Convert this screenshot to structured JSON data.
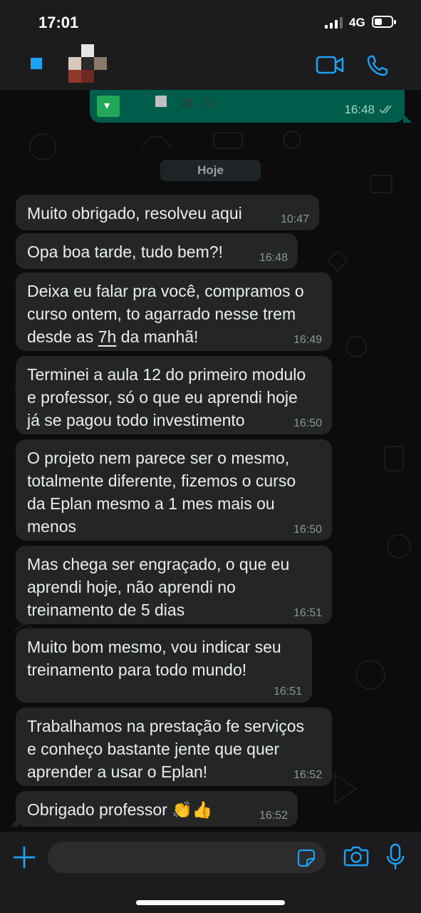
{
  "status_bar": {
    "time": "17:01",
    "network": "4G",
    "battery_level": 0.45
  },
  "header": {
    "back_icon": "back-chevron-icon",
    "avatar": "contact-avatar",
    "video_icon": "video-call-icon",
    "phone_icon": "voice-call-icon"
  },
  "sent_message": {
    "time": "16:48",
    "status_icon": "double-check-icon"
  },
  "date_divider": "Hoje",
  "messages": [
    {
      "lines": [
        "Muito obrigado, resolveu aqui"
      ],
      "time": "10:47"
    },
    {
      "lines": [
        "Opa boa tarde, tudo bem?!"
      ],
      "time": "16:48"
    },
    {
      "lines": [
        "Deixa eu falar pra você, compramos o",
        "curso ontem, to agarrado nesse trem",
        "desde as 7h da manhã!"
      ],
      "time": "16:49"
    },
    {
      "lines": [
        "Terminei a aula 12 do primeiro modulo",
        "e professor, só o que eu aprendi hoje",
        "já se pagou todo investimento"
      ],
      "time": "16:50"
    },
    {
      "lines": [
        "O projeto nem parece ser o mesmo,",
        "totalmente diferente, fizemos o curso",
        "da Eplan mesmo a 1 mes mais ou",
        "menos"
      ],
      "time": "16:50"
    },
    {
      "lines": [
        "Mas chega ser engraçado, o que eu",
        "aprendi hoje, não aprendi no",
        "treinamento de 5 dias"
      ],
      "time": "16:51"
    },
    {
      "lines": [
        "Muito bom mesmo, vou indicar seu",
        "treinamento para todo mundo!"
      ],
      "time": "16:51"
    },
    {
      "lines": [
        "Trabalhamos na prestação fe serviços",
        "e conheço bastante jente que quer",
        "aprender a usar o Eplan!"
      ],
      "time": "16:52"
    },
    {
      "lines": [
        "Obrigado professor 👏👍"
      ],
      "time": "16:52"
    }
  ],
  "input_bar": {
    "plus_icon": "plus-icon",
    "sticker_icon": "sticker-icon",
    "camera_icon": "camera-icon",
    "mic_icon": "microphone-icon"
  },
  "colors": {
    "accent": "#1da1f2",
    "sent_bubble": "#005c4b",
    "received_bubble": "#242626"
  }
}
